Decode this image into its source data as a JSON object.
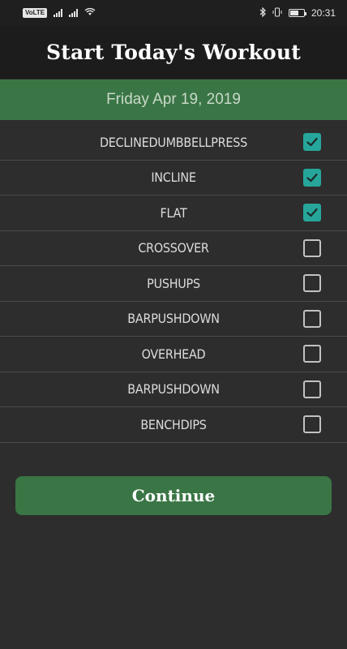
{
  "status_bar": {
    "left_badge": "VoLTE",
    "time": "20:31"
  },
  "header": {
    "title": "Start Today's Workout"
  },
  "date": "Friday Apr 19, 2019",
  "exercises": [
    {
      "label": "DECLINEDUMBBELLPRESS",
      "checked": true
    },
    {
      "label": "INCLINE",
      "checked": true
    },
    {
      "label": "FLAT",
      "checked": true
    },
    {
      "label": "CROSSOVER",
      "checked": false
    },
    {
      "label": "PUSHUPS",
      "checked": false
    },
    {
      "label": "BARPUSHDOWN",
      "checked": false
    },
    {
      "label": "OVERHEAD",
      "checked": false
    },
    {
      "label": "BARPUSHDOWN",
      "checked": false
    },
    {
      "label": "BENCHDIPS",
      "checked": false
    }
  ],
  "continue_label": "Continue",
  "colors": {
    "accent_green": "#3a7545",
    "checkbox_teal": "#26a69a",
    "background": "#2d2d2d"
  }
}
